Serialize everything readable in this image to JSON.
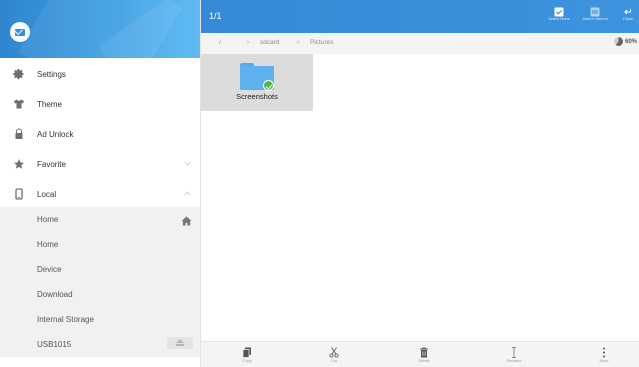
{
  "sidebar": {
    "menu": [
      {
        "label": "Settings",
        "icon": "gear-icon"
      },
      {
        "label": "Theme",
        "icon": "shirt-icon"
      },
      {
        "label": "Ad Unlock",
        "icon": "lock-icon"
      },
      {
        "label": "Favorite",
        "icon": "star-icon",
        "chevron": "chevron-down-icon"
      },
      {
        "label": "Local",
        "icon": "phone-icon",
        "chevron": "chevron-up-icon"
      }
    ],
    "local_items": [
      {
        "label": "Home",
        "icon": "home-icon"
      },
      {
        "label": "Home"
      },
      {
        "label": "Device"
      },
      {
        "label": "Download"
      },
      {
        "label": "Internal Storage"
      },
      {
        "label": "USB1015",
        "icon": "eject-icon"
      }
    ]
  },
  "topbar": {
    "counter": "1/1",
    "actions": [
      {
        "label": "Select None",
        "icon": "checkbox-checked-icon"
      },
      {
        "label": "Select Interval",
        "icon": "select-interval-icon"
      },
      {
        "label": "Close",
        "icon": "return-icon"
      }
    ]
  },
  "breadcrumb": {
    "items": [
      "/",
      ">",
      "sdcard",
      ">",
      "Pictures"
    ],
    "storage_percent": "60%"
  },
  "files": [
    {
      "name": "Screenshots",
      "icon": "folder-icon",
      "selected": true
    }
  ],
  "bottombar": {
    "actions": [
      {
        "label": "Copy",
        "icon": "copy-icon"
      },
      {
        "label": "Cut",
        "icon": "scissors-icon"
      },
      {
        "label": "Delete",
        "icon": "trash-icon"
      },
      {
        "label": "Rename",
        "icon": "text-cursor-icon"
      },
      {
        "label": "More",
        "icon": "more-vertical-icon"
      }
    ]
  },
  "colors": {
    "accent": "#3a8fdb",
    "selected_tile": "#dcdcdc",
    "folder": "#5eb0ee",
    "check": "#4db84f"
  }
}
